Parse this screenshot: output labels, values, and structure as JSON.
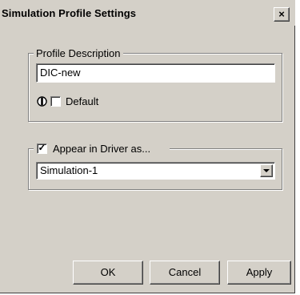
{
  "window": {
    "title": "Simulation Profile Settings",
    "close_label": "×"
  },
  "profile_description": {
    "legend": "Profile Description",
    "value": "DIC-new",
    "default_label": "Default",
    "default_checked": false
  },
  "appear_in_driver": {
    "label": "Appear in Driver as...",
    "checked": true,
    "check_mark": "✓",
    "selected_option": "Simulation-1"
  },
  "buttons": {
    "ok": "OK",
    "cancel": "Cancel",
    "apply": "Apply"
  }
}
